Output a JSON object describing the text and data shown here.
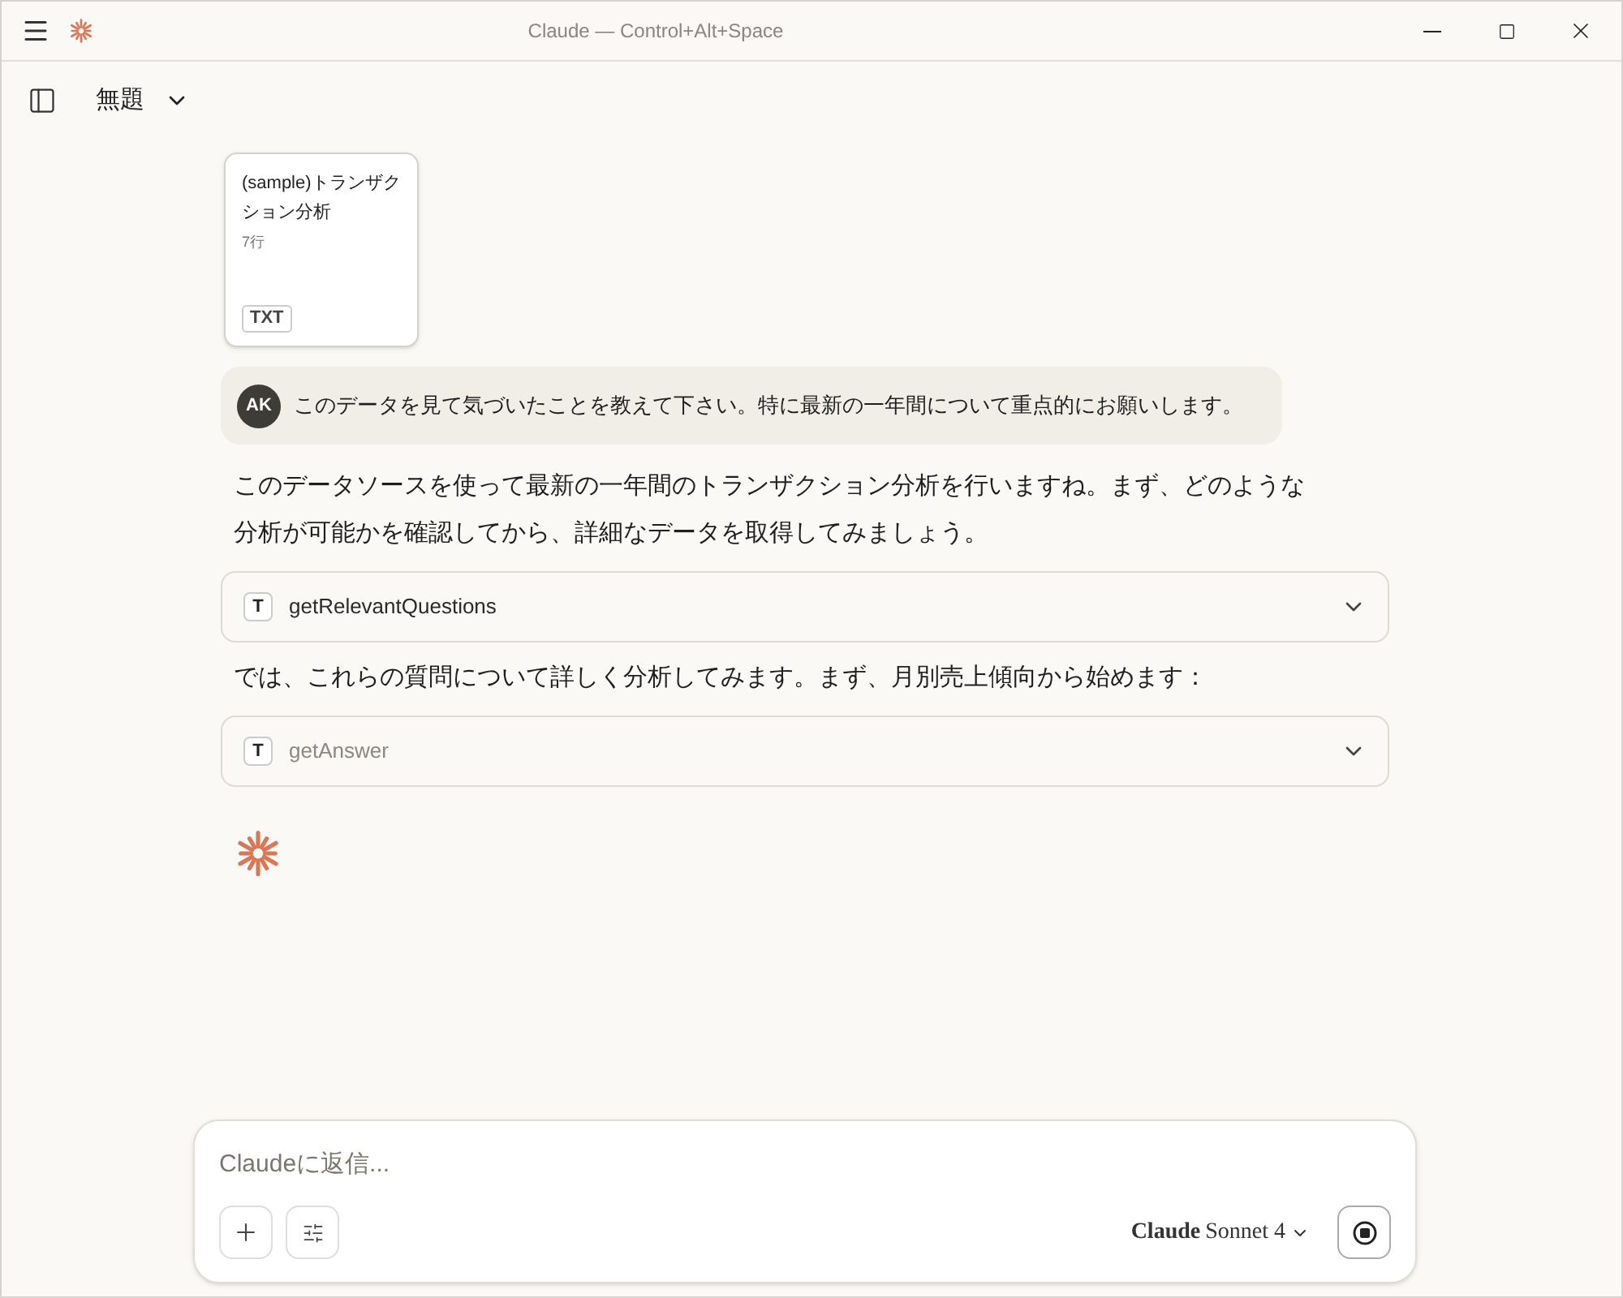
{
  "window": {
    "title": "Claude — Control+Alt+Space"
  },
  "header": {
    "title": "無題"
  },
  "attachment": {
    "name": "(sample)トランザクション分析",
    "meta": "7行",
    "type": "TXT"
  },
  "user_message": {
    "avatar": "AK",
    "text": "このデータを見て気づいたことを教えて下さい。特に最新の一年間について重点的にお願いします。"
  },
  "conversation": [
    {
      "kind": "text",
      "text": "このデータソースを使って最新の一年間のトランザクション分析を行いますね。まず、どのような分析が可能かを確認してから、詳細なデータを取得してみましょう。"
    },
    {
      "kind": "tool",
      "badge": "T",
      "name": "getRelevantQuestions",
      "done": true
    },
    {
      "kind": "text",
      "text": "では、これらの質問について詳しく分析してみます。まず、月別売上傾向から始めます："
    },
    {
      "kind": "tool",
      "badge": "T",
      "name": "getAnswer",
      "done": false
    }
  ],
  "composer": {
    "placeholder": "Claudeに返信...",
    "model_brand": "Claude",
    "model_name": "Sonnet 4"
  }
}
